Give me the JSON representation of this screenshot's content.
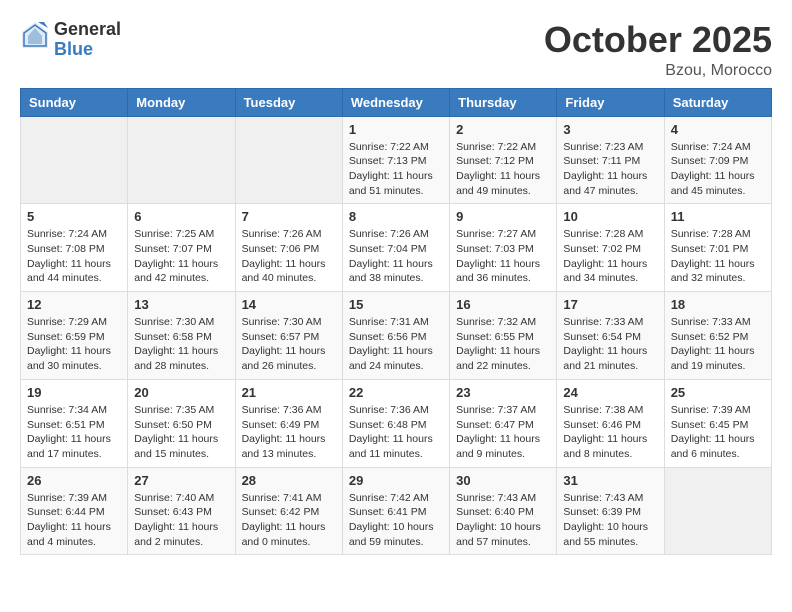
{
  "logo": {
    "general": "General",
    "blue": "Blue"
  },
  "header": {
    "month": "October 2025",
    "location": "Bzou, Morocco"
  },
  "weekdays": [
    "Sunday",
    "Monday",
    "Tuesday",
    "Wednesday",
    "Thursday",
    "Friday",
    "Saturday"
  ],
  "weeks": [
    [
      {
        "day": "",
        "info": ""
      },
      {
        "day": "",
        "info": ""
      },
      {
        "day": "",
        "info": ""
      },
      {
        "day": "1",
        "info": "Sunrise: 7:22 AM\nSunset: 7:13 PM\nDaylight: 11 hours\nand 51 minutes."
      },
      {
        "day": "2",
        "info": "Sunrise: 7:22 AM\nSunset: 7:12 PM\nDaylight: 11 hours\nand 49 minutes."
      },
      {
        "day": "3",
        "info": "Sunrise: 7:23 AM\nSunset: 7:11 PM\nDaylight: 11 hours\nand 47 minutes."
      },
      {
        "day": "4",
        "info": "Sunrise: 7:24 AM\nSunset: 7:09 PM\nDaylight: 11 hours\nand 45 minutes."
      }
    ],
    [
      {
        "day": "5",
        "info": "Sunrise: 7:24 AM\nSunset: 7:08 PM\nDaylight: 11 hours\nand 44 minutes."
      },
      {
        "day": "6",
        "info": "Sunrise: 7:25 AM\nSunset: 7:07 PM\nDaylight: 11 hours\nand 42 minutes."
      },
      {
        "day": "7",
        "info": "Sunrise: 7:26 AM\nSunset: 7:06 PM\nDaylight: 11 hours\nand 40 minutes."
      },
      {
        "day": "8",
        "info": "Sunrise: 7:26 AM\nSunset: 7:04 PM\nDaylight: 11 hours\nand 38 minutes."
      },
      {
        "day": "9",
        "info": "Sunrise: 7:27 AM\nSunset: 7:03 PM\nDaylight: 11 hours\nand 36 minutes."
      },
      {
        "day": "10",
        "info": "Sunrise: 7:28 AM\nSunset: 7:02 PM\nDaylight: 11 hours\nand 34 minutes."
      },
      {
        "day": "11",
        "info": "Sunrise: 7:28 AM\nSunset: 7:01 PM\nDaylight: 11 hours\nand 32 minutes."
      }
    ],
    [
      {
        "day": "12",
        "info": "Sunrise: 7:29 AM\nSunset: 6:59 PM\nDaylight: 11 hours\nand 30 minutes."
      },
      {
        "day": "13",
        "info": "Sunrise: 7:30 AM\nSunset: 6:58 PM\nDaylight: 11 hours\nand 28 minutes."
      },
      {
        "day": "14",
        "info": "Sunrise: 7:30 AM\nSunset: 6:57 PM\nDaylight: 11 hours\nand 26 minutes."
      },
      {
        "day": "15",
        "info": "Sunrise: 7:31 AM\nSunset: 6:56 PM\nDaylight: 11 hours\nand 24 minutes."
      },
      {
        "day": "16",
        "info": "Sunrise: 7:32 AM\nSunset: 6:55 PM\nDaylight: 11 hours\nand 22 minutes."
      },
      {
        "day": "17",
        "info": "Sunrise: 7:33 AM\nSunset: 6:54 PM\nDaylight: 11 hours\nand 21 minutes."
      },
      {
        "day": "18",
        "info": "Sunrise: 7:33 AM\nSunset: 6:52 PM\nDaylight: 11 hours\nand 19 minutes."
      }
    ],
    [
      {
        "day": "19",
        "info": "Sunrise: 7:34 AM\nSunset: 6:51 PM\nDaylight: 11 hours\nand 17 minutes."
      },
      {
        "day": "20",
        "info": "Sunrise: 7:35 AM\nSunset: 6:50 PM\nDaylight: 11 hours\nand 15 minutes."
      },
      {
        "day": "21",
        "info": "Sunrise: 7:36 AM\nSunset: 6:49 PM\nDaylight: 11 hours\nand 13 minutes."
      },
      {
        "day": "22",
        "info": "Sunrise: 7:36 AM\nSunset: 6:48 PM\nDaylight: 11 hours\nand 11 minutes."
      },
      {
        "day": "23",
        "info": "Sunrise: 7:37 AM\nSunset: 6:47 PM\nDaylight: 11 hours\nand 9 minutes."
      },
      {
        "day": "24",
        "info": "Sunrise: 7:38 AM\nSunset: 6:46 PM\nDaylight: 11 hours\nand 8 minutes."
      },
      {
        "day": "25",
        "info": "Sunrise: 7:39 AM\nSunset: 6:45 PM\nDaylight: 11 hours\nand 6 minutes."
      }
    ],
    [
      {
        "day": "26",
        "info": "Sunrise: 7:39 AM\nSunset: 6:44 PM\nDaylight: 11 hours\nand 4 minutes."
      },
      {
        "day": "27",
        "info": "Sunrise: 7:40 AM\nSunset: 6:43 PM\nDaylight: 11 hours\nand 2 minutes."
      },
      {
        "day": "28",
        "info": "Sunrise: 7:41 AM\nSunset: 6:42 PM\nDaylight: 11 hours\nand 0 minutes."
      },
      {
        "day": "29",
        "info": "Sunrise: 7:42 AM\nSunset: 6:41 PM\nDaylight: 10 hours\nand 59 minutes."
      },
      {
        "day": "30",
        "info": "Sunrise: 7:43 AM\nSunset: 6:40 PM\nDaylight: 10 hours\nand 57 minutes."
      },
      {
        "day": "31",
        "info": "Sunrise: 7:43 AM\nSunset: 6:39 PM\nDaylight: 10 hours\nand 55 minutes."
      },
      {
        "day": "",
        "info": ""
      }
    ]
  ]
}
